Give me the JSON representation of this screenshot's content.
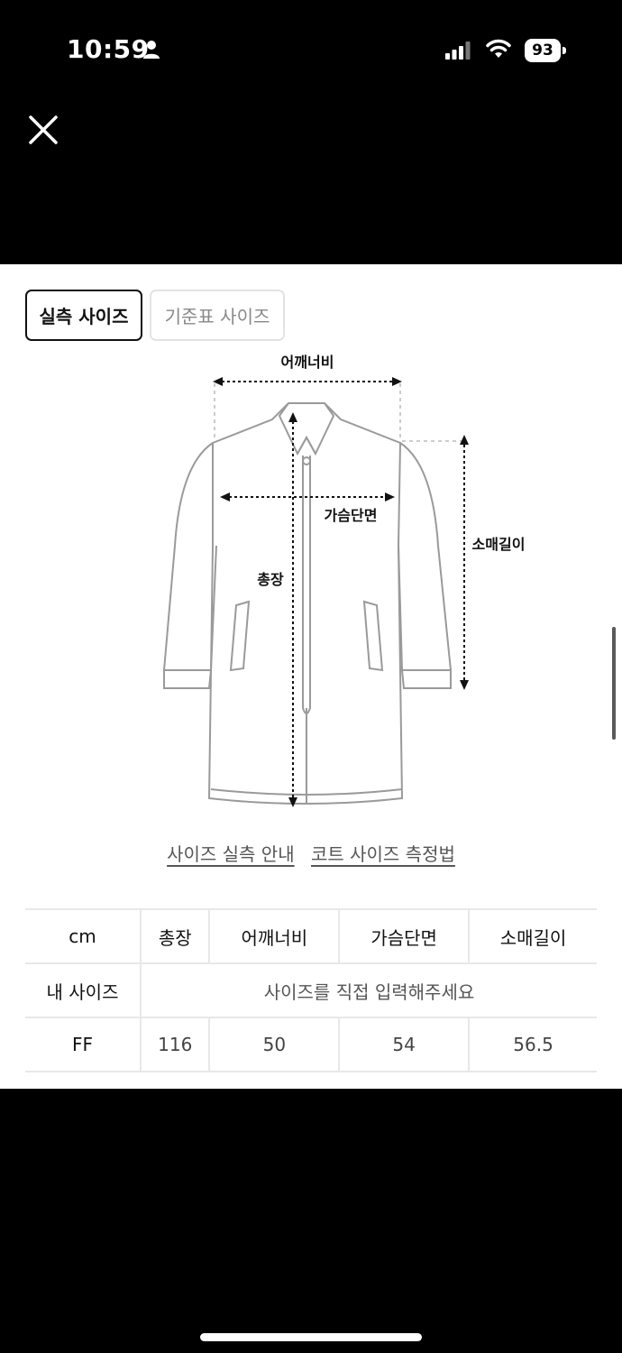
{
  "status": {
    "time": "10:59",
    "battery": "93"
  },
  "tabs": [
    {
      "label": "실측 사이즈"
    },
    {
      "label": "기준표 사이즈"
    }
  ],
  "diagram": {
    "shoulder_label": "어깨너비",
    "chest_label": "가슴단면",
    "length_label": "총장",
    "sleeve_label": "소매길이"
  },
  "links": {
    "guide": "사이즈 실측 안내",
    "measure": "코트 사이즈 측정법"
  },
  "table": {
    "headers": [
      "cm",
      "총장",
      "어깨너비",
      "가슴단면",
      "소매길이"
    ],
    "my_size_label": "내 사이즈",
    "my_size_placeholder": "사이즈를 직접 입력해주세요",
    "rows": [
      {
        "size": "FF",
        "values": [
          "116",
          "50",
          "54",
          "56.5"
        ]
      }
    ]
  },
  "colors": {
    "background": "#000000",
    "panel": "#ffffff",
    "outline": "#9a9a9a"
  }
}
